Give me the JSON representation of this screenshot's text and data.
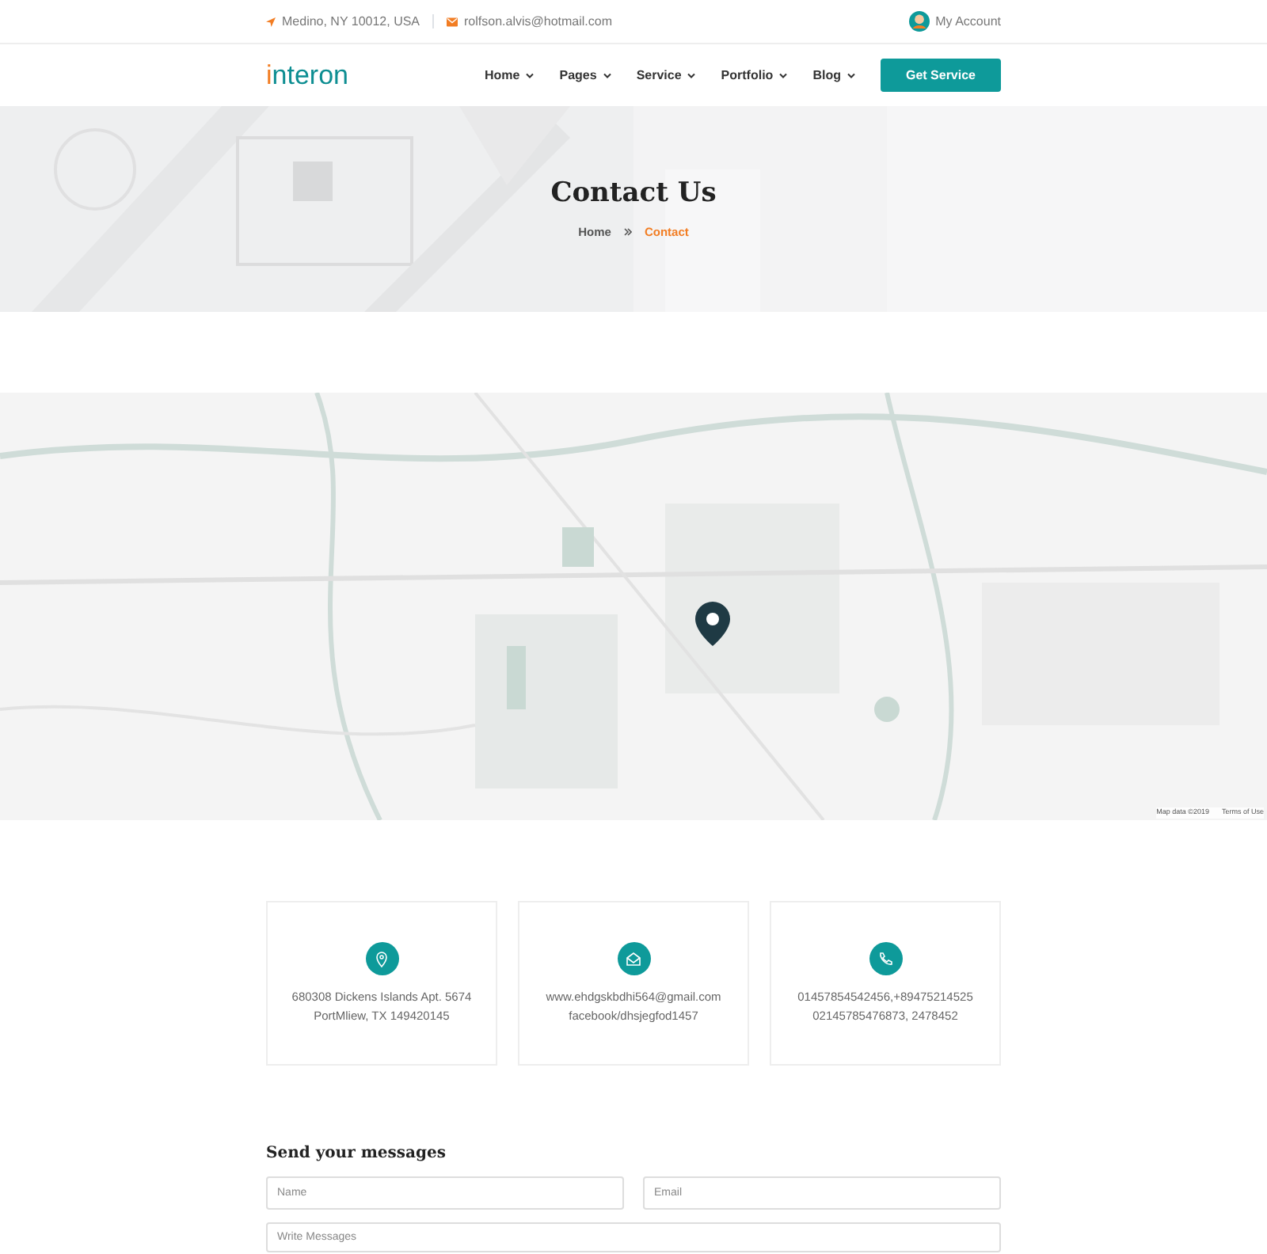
{
  "topbar": {
    "address": "Medino, NY 10012, USA",
    "email": "rolfson.alvis@hotmail.com",
    "account": "My Account"
  },
  "navbar": {
    "logo_first": "i",
    "logo_rest": "nteron",
    "menu": [
      {
        "label": "Home"
      },
      {
        "label": "Pages"
      },
      {
        "label": "Service"
      },
      {
        "label": "Portfolio"
      },
      {
        "label": "Blog"
      }
    ],
    "cta": "Get Service"
  },
  "hero": {
    "title": "Contact Us",
    "breadcrumb": [
      {
        "label": "Home",
        "selected": false
      },
      {
        "label": "Contact",
        "selected": true
      }
    ]
  },
  "map": {
    "kind": "picture",
    "attribution": "Map data ©2019",
    "terms": "Terms of Use"
  },
  "contact_cards": [
    {
      "kind": "location",
      "lines": [
        "680308 Dickens Islands Apt. 5674",
        "PortMliew, TX 149420145"
      ]
    },
    {
      "kind": "email",
      "lines": [
        "www.ehdgskbdhi564@gmail.com",
        "facebook/dhsjegfod1457"
      ]
    },
    {
      "kind": "phone",
      "lines": [
        "01457854542456,+89475214525",
        "02145785476873, 2478452"
      ]
    }
  ],
  "form": {
    "title": "Send your messages",
    "fields": [
      {
        "kind": "input",
        "placeholder": "Name"
      },
      {
        "kind": "input",
        "placeholder": "Email"
      },
      {
        "kind": "textarea",
        "placeholder": "Write Messages"
      }
    ]
  }
}
